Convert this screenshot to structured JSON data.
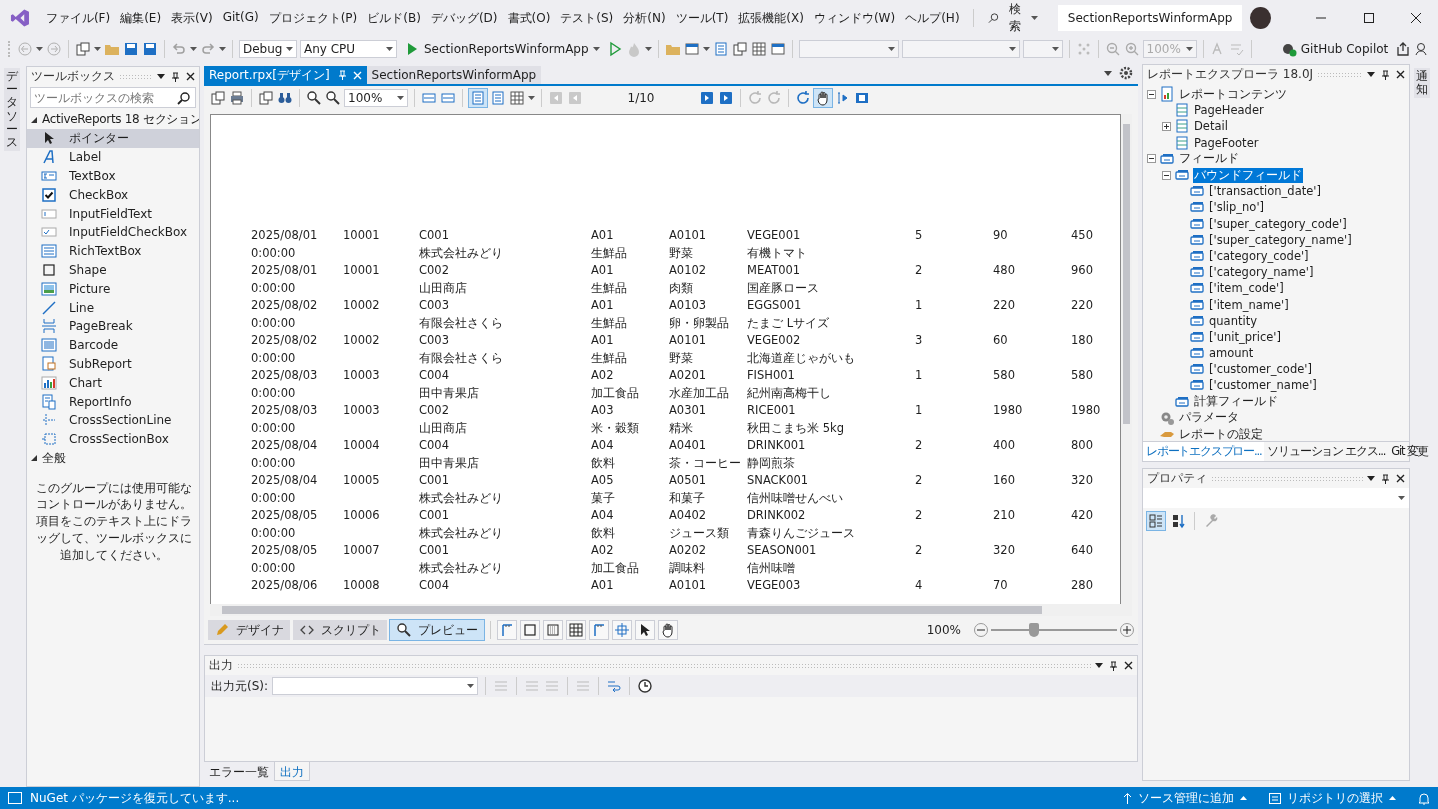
{
  "title_bar": {
    "menus": [
      "ファイル(F)",
      "編集(E)",
      "表示(V)",
      "Git(G)",
      "プロジェクト(P)",
      "ビルド(B)",
      "デバッグ(D)",
      "書式(O)",
      "テスト(S)",
      "分析(N)",
      "ツール(T)",
      "拡張機能(X)",
      "ウィンドウ(W)",
      "ヘルプ(H)"
    ],
    "search": "検索",
    "solution": "SectionReportsWinformApp"
  },
  "toolbar": {
    "configuration": "Debug",
    "platform": "Any CPU",
    "start_target": "SectionReportsWinformApp",
    "zoom": "100%",
    "copilot": "GitHub Copilot"
  },
  "side_strips": {
    "left": "データソース",
    "right": "通知"
  },
  "toolbox": {
    "title": "ツールボックス",
    "search_placeholder": "ツールボックスの検索",
    "groups": [
      {
        "label": "ActiveReports 18 セクション",
        "expanded": true,
        "items": [
          {
            "label": "ポインター",
            "selected": true
          },
          {
            "label": "Label",
            "selected": false
          },
          {
            "label": "TextBox",
            "selected": false
          },
          {
            "label": "CheckBox",
            "selected": false
          },
          {
            "label": "InputFieldText",
            "selected": false
          },
          {
            "label": "InputFieldCheckBox",
            "selected": false
          },
          {
            "label": "RichTextBox",
            "selected": false
          },
          {
            "label": "Shape",
            "selected": false
          },
          {
            "label": "Picture",
            "selected": false
          },
          {
            "label": "Line",
            "selected": false
          },
          {
            "label": "PageBreak",
            "selected": false
          },
          {
            "label": "Barcode",
            "selected": false
          },
          {
            "label": "SubReport",
            "selected": false
          },
          {
            "label": "Chart",
            "selected": false
          },
          {
            "label": "ReportInfo",
            "selected": false
          },
          {
            "label": "CrossSectionLine",
            "selected": false
          },
          {
            "label": "CrossSectionBox",
            "selected": false
          }
        ]
      },
      {
        "label": "全般",
        "expanded": true,
        "message": "このグループには使用可能なコントロールがありません。項目をこのテキスト上にドラッグして、ツールボックスに追加してください。"
      }
    ]
  },
  "document_tabs": [
    {
      "label": "Report.rpx[デザイン]",
      "selected": true
    },
    {
      "label": "SectionReportsWinformApp",
      "selected": false
    }
  ],
  "report_toolbar": {
    "zoom": "100%",
    "page": "1/10"
  },
  "report": {
    "rows": [
      {
        "date": "2025/08/01",
        "time": "0:00:00",
        "slip_no": "10001",
        "customer_code": "C001",
        "customer_name": "株式会社みどり",
        "super_category_code": "A01",
        "super_category_name": "生鮮品",
        "category_code": "A0101",
        "category_name": "野菜",
        "item_code": "VEGE001",
        "item_name": "有機トマト",
        "quantity": "5",
        "unit_price": "90",
        "amount": "450"
      },
      {
        "date": "2025/08/01",
        "time": "0:00:00",
        "slip_no": "10001",
        "customer_code": "C002",
        "customer_name": "山田商店",
        "super_category_code": "A01",
        "super_category_name": "生鮮品",
        "category_code": "A0102",
        "category_name": "肉類",
        "item_code": "MEAT001",
        "item_name": "国産豚ロース",
        "quantity": "2",
        "unit_price": "480",
        "amount": "960"
      },
      {
        "date": "2025/08/02",
        "time": "0:00:00",
        "slip_no": "10002",
        "customer_code": "C003",
        "customer_name": "有限会社さくら",
        "super_category_code": "A01",
        "super_category_name": "生鮮品",
        "category_code": "A0103",
        "category_name": "卵・卵製品",
        "item_code": "EGGS001",
        "item_name": "たまご Lサイズ",
        "quantity": "1",
        "unit_price": "220",
        "amount": "220"
      },
      {
        "date": "2025/08/02",
        "time": "0:00:00",
        "slip_no": "10002",
        "customer_code": "C003",
        "customer_name": "有限会社さくら",
        "super_category_code": "A01",
        "super_category_name": "生鮮品",
        "category_code": "A0101",
        "category_name": "野菜",
        "item_code": "VEGE002",
        "item_name": "北海道産じゃがいも",
        "quantity": "3",
        "unit_price": "60",
        "amount": "180"
      },
      {
        "date": "2025/08/03",
        "time": "0:00:00",
        "slip_no": "10003",
        "customer_code": "C004",
        "customer_name": "田中青果店",
        "super_category_code": "A02",
        "super_category_name": "加工食品",
        "category_code": "A0201",
        "category_name": "水産加工品",
        "item_code": "FISH001",
        "item_name": "紀州南高梅干し",
        "quantity": "1",
        "unit_price": "580",
        "amount": "580"
      },
      {
        "date": "2025/08/03",
        "time": "0:00:00",
        "slip_no": "10003",
        "customer_code": "C002",
        "customer_name": "山田商店",
        "super_category_code": "A03",
        "super_category_name": "米・穀類",
        "category_code": "A0301",
        "category_name": "精米",
        "item_code": "RICE001",
        "item_name": "秋田こまち米 5kg",
        "quantity": "1",
        "unit_price": "1980",
        "amount": "1980"
      },
      {
        "date": "2025/08/04",
        "time": "0:00:00",
        "slip_no": "10004",
        "customer_code": "C004",
        "customer_name": "田中青果店",
        "super_category_code": "A04",
        "super_category_name": "飲料",
        "category_code": "A0401",
        "category_name": "茶・コーヒー",
        "item_code": "DRINK001",
        "item_name": "静岡煎茶",
        "quantity": "2",
        "unit_price": "400",
        "amount": "800"
      },
      {
        "date": "2025/08/04",
        "time": "0:00:00",
        "slip_no": "10005",
        "customer_code": "C001",
        "customer_name": "株式会社みどり",
        "super_category_code": "A05",
        "super_category_name": "菓子",
        "category_code": "A0501",
        "category_name": "和菓子",
        "item_code": "SNACK001",
        "item_name": "信州味噌せんべい",
        "quantity": "2",
        "unit_price": "160",
        "amount": "320"
      },
      {
        "date": "2025/08/05",
        "time": "0:00:00",
        "slip_no": "10006",
        "customer_code": "C001",
        "customer_name": "株式会社みどり",
        "super_category_code": "A04",
        "super_category_name": "飲料",
        "category_code": "A0402",
        "category_name": "ジュース類",
        "item_code": "DRINK002",
        "item_name": "青森りんごジュース",
        "quantity": "2",
        "unit_price": "210",
        "amount": "420"
      },
      {
        "date": "2025/08/05",
        "time": "0:00:00",
        "slip_no": "10007",
        "customer_code": "C001",
        "customer_name": "株式会社みどり",
        "super_category_code": "A02",
        "super_category_name": "加工食品",
        "category_code": "A0202",
        "category_name": "調味料",
        "item_code": "SEASON001",
        "item_name": "信州味噌",
        "quantity": "2",
        "unit_price": "320",
        "amount": "640"
      },
      {
        "date": "2025/08/06",
        "slip_no": "10008",
        "customer_code": "C004",
        "super_category_code": "A01",
        "category_code": "A0101",
        "item_code": "VEGE003",
        "quantity": "4",
        "unit_price": "70",
        "amount": "280"
      }
    ]
  },
  "designer_tabs": [
    {
      "label": "デザイナ",
      "selected": false
    },
    {
      "label": "スクリプト",
      "selected": false
    },
    {
      "label": "プレビュー",
      "selected": true
    }
  ],
  "designer_zoom": {
    "reading": "100%",
    "level": 0.34
  },
  "output": {
    "title": "出力",
    "source_label": "出力元(S):"
  },
  "bottom_tabs": [
    {
      "label": "エラー一覧",
      "selected": false
    },
    {
      "label": "出力",
      "selected": true
    }
  ],
  "report_explorer": {
    "title": "レポートエクスプローラ 18.0J",
    "tree": [
      {
        "label": "レポートコンテンツ",
        "kind": "report",
        "selected": false,
        "expanded": true,
        "children": [
          {
            "label": "PageHeader",
            "kind": "section",
            "selected": false
          },
          {
            "label": "Detail",
            "kind": "section",
            "selected": false,
            "expanded": false
          },
          {
            "label": "PageFooter",
            "kind": "section",
            "selected": false
          }
        ]
      },
      {
        "label": "フィールド",
        "kind": "field",
        "selected": false,
        "expanded": true,
        "children": [
          {
            "label": "バウンドフィールド",
            "kind": "field",
            "selected": true,
            "expanded": true,
            "children": [
              {
                "label": "['transaction_date']",
                "kind": "field",
                "selected": false
              },
              {
                "label": "['slip_no']",
                "kind": "field",
                "selected": false
              },
              {
                "label": "['super_category_code']",
                "kind": "field",
                "selected": false
              },
              {
                "label": "['super_category_name']",
                "kind": "field",
                "selected": false
              },
              {
                "label": "['category_code']",
                "kind": "field",
                "selected": false
              },
              {
                "label": "['category_name']",
                "kind": "field",
                "selected": false
              },
              {
                "label": "['item_code']",
                "kind": "field",
                "selected": false
              },
              {
                "label": "['item_name']",
                "kind": "field",
                "selected": false
              },
              {
                "label": "quantity",
                "kind": "field",
                "selected": false
              },
              {
                "label": "['unit_price']",
                "kind": "field",
                "selected": false
              },
              {
                "label": "amount",
                "kind": "field",
                "selected": false
              },
              {
                "label": "['customer_code']",
                "kind": "field",
                "selected": false
              },
              {
                "label": "['customer_name']",
                "kind": "field",
                "selected": false
              }
            ]
          },
          {
            "label": "計算フィールド",
            "kind": "field",
            "selected": false
          }
        ]
      },
      {
        "label": "パラメータ",
        "kind": "parameters",
        "selected": false
      },
      {
        "label": "レポートの設定",
        "kind": "settings",
        "selected": false
      }
    ]
  },
  "explorer_tabs": [
    {
      "label": "レポートエクスプロー...",
      "selected": true
    },
    {
      "label": "ソリューション エクス...",
      "selected": false
    },
    {
      "label": "Git 変更",
      "selected": false
    }
  ],
  "properties": {
    "title": "プロパティ"
  },
  "status_bar": {
    "message": "NuGet パッケージを復元しています...",
    "items": [
      "ソース管理に追加",
      "リポジトリの選択"
    ]
  }
}
